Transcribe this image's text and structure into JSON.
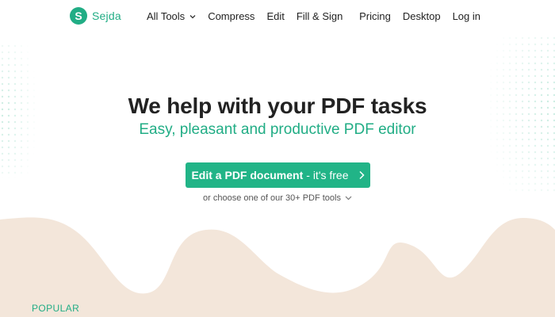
{
  "header": {
    "logo_letter": "S",
    "logo_text": "Sejda",
    "nav_left": [
      {
        "label": "All Tools",
        "has_dropdown": true
      },
      {
        "label": "Compress"
      },
      {
        "label": "Edit"
      },
      {
        "label": "Fill & Sign"
      }
    ],
    "nav_right": [
      {
        "label": "Pricing"
      },
      {
        "label": "Desktop"
      },
      {
        "label": "Log in"
      }
    ]
  },
  "hero": {
    "title": "We help with your PDF tasks",
    "subtitle": "Easy, pleasant and productive PDF editor",
    "cta_strong": "Edit a PDF document",
    "cta_rest": "- it's free",
    "more_tools": "or choose one of our 30+ PDF tools"
  },
  "section": {
    "popular_label": "POPULAR"
  },
  "colors": {
    "brand_green": "#21ad85",
    "cta_green": "#21b487",
    "wave_beige": "#f3e6da",
    "dot_color": "#c9ece1"
  },
  "icons": {
    "dropdown": "chevron-down-icon",
    "cta": "chevron-right-icon"
  }
}
